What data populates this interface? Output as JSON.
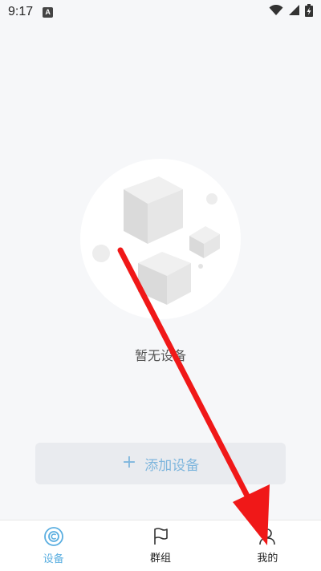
{
  "status_bar": {
    "time": "9:17",
    "notification_badge": "A",
    "icons": [
      "wifi-icon",
      "signal-icon",
      "battery-charging-icon"
    ]
  },
  "empty_state": {
    "message": "暂无设备",
    "illustration": "empty-boxes-illustration"
  },
  "add_device": {
    "icon": "+",
    "label": "添加设备"
  },
  "bottom_nav": {
    "items": [
      {
        "label": "设备",
        "icon": "device-target-icon",
        "active": true
      },
      {
        "label": "群组",
        "icon": "flag-icon",
        "active": false
      },
      {
        "label": "我的",
        "icon": "person-icon",
        "active": false
      }
    ]
  },
  "colors": {
    "accent": "#5aaee0",
    "annotation_arrow": "#f01818",
    "background": "#f6f7f9"
  }
}
